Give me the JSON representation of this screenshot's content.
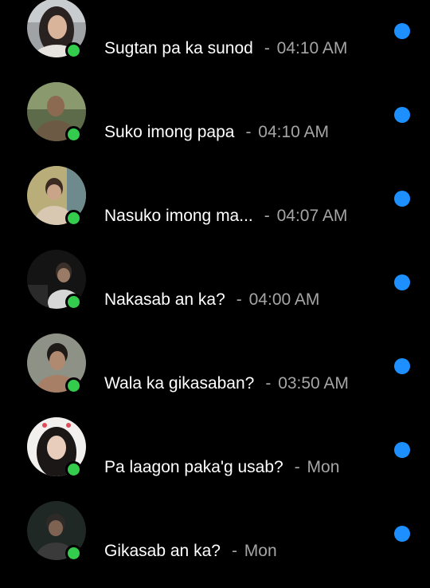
{
  "colors": {
    "background": "#000000",
    "message_text": "#ffffff",
    "timestamp_text": "#a5a5a5",
    "online_indicator": "#33cc4c",
    "unread_indicator": "#1d8fff"
  },
  "conversations": [
    {
      "preview": "Sugtan pa ka sunod",
      "separator": "-",
      "time": "04:10 AM",
      "online": true,
      "unread": true,
      "avatar_icon": "profile-photo"
    },
    {
      "preview": "Suko imong papa",
      "separator": "-",
      "time": "04:10 AM",
      "online": true,
      "unread": true,
      "avatar_icon": "profile-photo"
    },
    {
      "preview": "Nasuko imong ma...",
      "separator": "-",
      "time": "04:07 AM",
      "online": true,
      "unread": true,
      "avatar_icon": "profile-photo"
    },
    {
      "preview": "Nakasab an ka?",
      "separator": "-",
      "time": "04:00 AM",
      "online": true,
      "unread": true,
      "avatar_icon": "profile-photo"
    },
    {
      "preview": "Wala ka gikasaban?",
      "separator": "-",
      "time": "03:50 AM",
      "online": true,
      "unread": true,
      "avatar_icon": "profile-photo"
    },
    {
      "preview": "Pa laagon paka'g usab?",
      "separator": "-",
      "time": "Mon",
      "online": true,
      "unread": true,
      "avatar_icon": "profile-photo"
    },
    {
      "preview": "Gikasab an ka?",
      "separator": "-",
      "time": "Mon",
      "online": true,
      "unread": true,
      "avatar_icon": "profile-photo"
    }
  ]
}
